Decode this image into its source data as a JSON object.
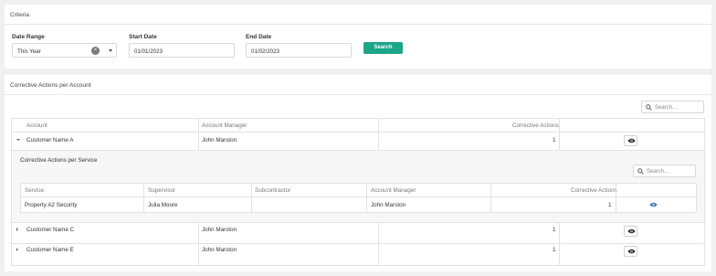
{
  "criteria": {
    "title": "Criteria",
    "date_range_label": "Date Range",
    "date_range_value": "This Year",
    "start_date_label": "Start Date",
    "start_date_value": "01/01/2023",
    "end_date_label": "End Date",
    "end_date_value": "01/02/2023",
    "search_button": "Search"
  },
  "capa": {
    "title": "Corrective Actions per Account",
    "search_placeholder": "Search...",
    "columns": [
      "Account",
      "Account Manager",
      "Corrective Actions"
    ],
    "rows": [
      {
        "account": "Customer Name A",
        "manager": "John Marston",
        "count": "1",
        "expanded": true
      },
      {
        "account": "Customer Name C",
        "manager": "John Marston",
        "count": "1",
        "expanded": false
      },
      {
        "account": "Customer Name E",
        "manager": "John Marston",
        "count": "1",
        "expanded": false
      }
    ],
    "nested": {
      "title": "Corrective Actions per Service",
      "search_placeholder": "Search...",
      "columns": [
        "Service",
        "Supervisor",
        "Subcontractor",
        "Account Manager",
        "Corrective Actions"
      ],
      "rows": [
        {
          "service": "Property A2 Security",
          "supervisor": "Julia Moore",
          "subcontractor": "",
          "manager": "John Marston",
          "count": "1"
        }
      ]
    }
  },
  "icons": {
    "view": "eye-icon",
    "search": "search-icon",
    "clear": "clear-icon",
    "dropdown": "chevron-down-icon",
    "collapse": "caret-down-icon",
    "expand": "caret-right-icon"
  },
  "colors": {
    "accent": "#1ba589",
    "link_eye": "#2a6fb0"
  }
}
